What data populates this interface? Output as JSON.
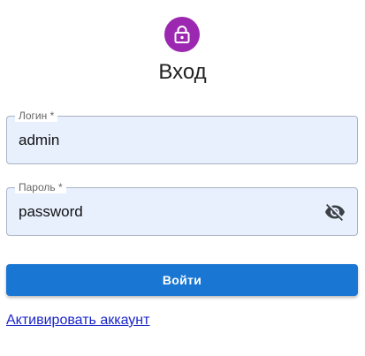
{
  "header": {
    "icon": "lock-icon",
    "title": "Вход"
  },
  "form": {
    "login": {
      "label": "Логин *",
      "value": "admin"
    },
    "password": {
      "label": "Пароль *",
      "value": "password",
      "toggle_icon": "eye-off-icon"
    },
    "submit_label": "Войти"
  },
  "links": {
    "activate_account": "Активировать аккаунт"
  },
  "colors": {
    "avatar_bg": "#9c27b0",
    "primary": "#1976d2",
    "input_bg": "#e8f0fe",
    "link": "#1a25c9"
  }
}
